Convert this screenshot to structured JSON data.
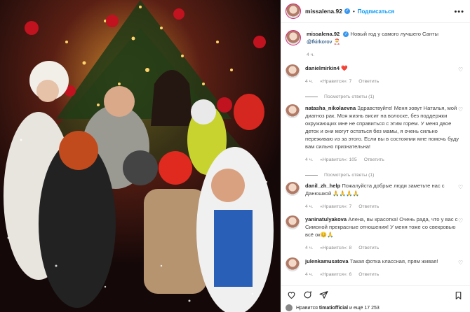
{
  "post": {
    "author": "missalena.92",
    "follow_label": "Подписаться",
    "more_label": "•••",
    "caption": {
      "author": "missalena.92",
      "text": "Новый год у самого лучшего Санты",
      "mention": "@fkirkorov",
      "tail": "🎅",
      "time": "4 ч."
    }
  },
  "comments": [
    {
      "user": "danielmirkin4",
      "text": "❤️",
      "time": "4 ч.",
      "likes": "«Нравится»: 7",
      "reply_label": "Ответить",
      "replies_label": "Посмотреть ответы (1)"
    },
    {
      "user": "natasha_nikolaevna",
      "text": "Здравствуйте! Меня зовут Наталья, мой диагноз рак. Моя жизнь висит на волоске, без поддержки окружающих мне не справиться с этим горем. У меня двое деток и они могут остаться без мамы, я очень сильно переживаю из за этого. Если вы в состоянии мне помочь буду вам сильно признательна!",
      "time": "4 ч.",
      "likes": "«Нравится»: 105",
      "reply_label": "Ответить",
      "replies_label": "Посмотреть ответы (1)"
    },
    {
      "user": "danil_zh_help",
      "text": "Пожалуйста добрые люди заметьте нас с Данюшкой 🙏🙏🙏🙏",
      "time": "4 ч.",
      "likes": "«Нравится»: 7",
      "reply_label": "Ответить"
    },
    {
      "user": "yaninatulyakova",
      "text": "Алена, вы красотка! Очень рада, что у вас с Симоной прекрасные отношения! У меня тоже со свекровью всё ок😊🙏",
      "time": "4 ч.",
      "likes": "«Нравится»: 8",
      "reply_label": "Ответить"
    },
    {
      "user": "julenkamusatova",
      "text": "Такая фотка классная, прям живая!",
      "time": "4 ч.",
      "likes": "«Нравится»: 6",
      "reply_label": "Ответить"
    }
  ],
  "footer": {
    "liked_by_prefix": "Нравится",
    "liked_by_user": "timatiofficial",
    "liked_by_suffix": "и ещё 17 253"
  },
  "colors": {
    "accent": "#0095f6",
    "verified": "#3897f0",
    "muted": "#8e8e8e"
  },
  "icons": [
    "more-icon",
    "heart-icon",
    "comment-icon",
    "share-icon",
    "bookmark-icon",
    "verified-icon"
  ]
}
